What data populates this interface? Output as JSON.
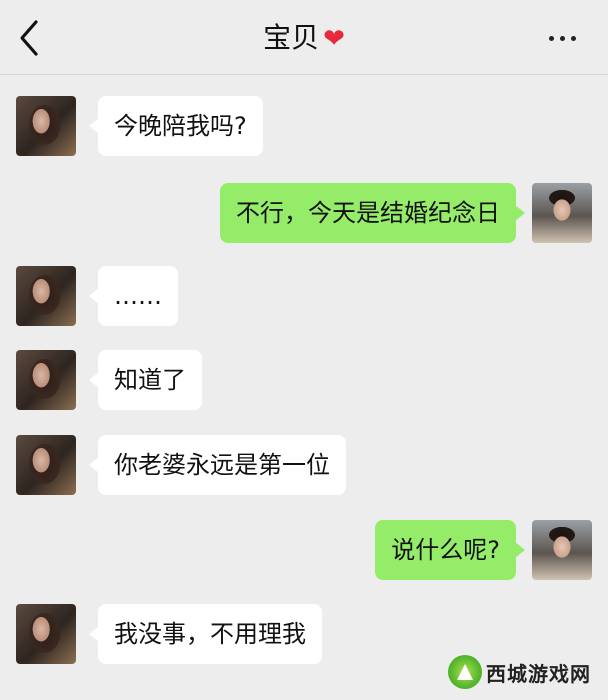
{
  "header": {
    "title": "宝贝",
    "title_emoji": "❤"
  },
  "messages": [
    {
      "side": "left",
      "text": "今晚陪我吗?"
    },
    {
      "side": "right",
      "text": "不行，今天是结婚纪念日"
    },
    {
      "side": "left",
      "text": "……"
    },
    {
      "side": "left",
      "text": "知道了"
    },
    {
      "side": "left",
      "text": "你老婆永远是第一位"
    },
    {
      "side": "right",
      "text": "说什么呢?"
    },
    {
      "side": "left",
      "text": "我没事，不用理我"
    }
  ],
  "watermark": {
    "text": "西城游戏网"
  },
  "colors": {
    "background": "#ededed",
    "incoming_bubble": "#ffffff",
    "outgoing_bubble": "#95ec69",
    "heart": "#e8293b"
  }
}
